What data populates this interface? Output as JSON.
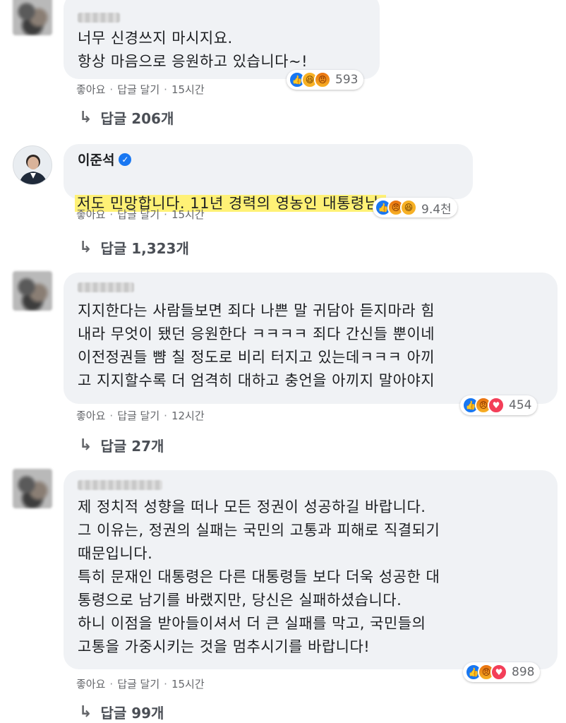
{
  "comments": [
    {
      "author": "",
      "verified": false,
      "text": "너무 신경쓰지 마시지요.\n항상 마음으로 응원하고 있습니다~!",
      "reaction_count": "593",
      "reactions": [
        "like-icon",
        "haha-icon",
        "angry-icon"
      ],
      "meta": {
        "like": "좋아요",
        "reply": "답글 달기",
        "time": "15시간"
      },
      "replies": "답글 206개"
    },
    {
      "author": "이준석",
      "verified": true,
      "text": "저도 민망합니다. 11년 경력의 영농인 대통령님.",
      "reaction_count": "9.4천",
      "reactions": [
        "like-icon",
        "angry-icon",
        "haha-icon"
      ],
      "meta": {
        "like": "좋아요",
        "reply": "답글 달기",
        "time": "15시간"
      },
      "replies": "답글 1,323개"
    },
    {
      "author": "",
      "verified": false,
      "text": "지지한다는 사람들보면 죄다 나쁜 말 귀담아 듣지마라 힘\n내라 무엇이 됐던 응원한다 ㅋㅋㅋㅋ 죄다 간신들 뿐이네\n이전정권들 뺨 칠 정도로 비리 터지고 있는데ㅋㅋㅋ 아끼\n고 지지할수록 더 엄격히 대하고 충언을 아끼지 말아야지",
      "reaction_count": "454",
      "reactions": [
        "like-icon",
        "angry-icon",
        "love-icon"
      ],
      "meta": {
        "like": "좋아요",
        "reply": "답글 달기",
        "time": "12시간"
      },
      "replies": "답글 27개"
    },
    {
      "author": "",
      "verified": false,
      "text": "제 정치적 성향을 떠나 모든 정권이 성공하길 바랍니다.\n그 이유는, 정권의 실패는 국민의 고통과 피해로 직결되기\n때문입니다.\n특히 문재인 대통령은 다른 대통령들 보다 더욱 성공한 대\n통령으로 남기를 바랬지만, 당신은 실패하셨습니다.\n하니 이점을 받아들이셔서 더 큰 실패를 막고, 국민들의\n고통을 가중시키는 것을 멈추시기를 바랍니다!",
      "reaction_count": "898",
      "reactions": [
        "like-icon",
        "angry-icon",
        "love-icon"
      ],
      "meta": {
        "like": "좋아요",
        "reply": "답글 달기",
        "time": "15시간"
      },
      "replies": "답글 99개"
    }
  ],
  "icons": {
    "reply": "reply-arrow-icon",
    "verified": "verified-badge-icon"
  },
  "colors": {
    "bubble": "#f0f2f5",
    "highlight": "#fff176",
    "like": "#1877f2",
    "meta": "#65676b"
  }
}
